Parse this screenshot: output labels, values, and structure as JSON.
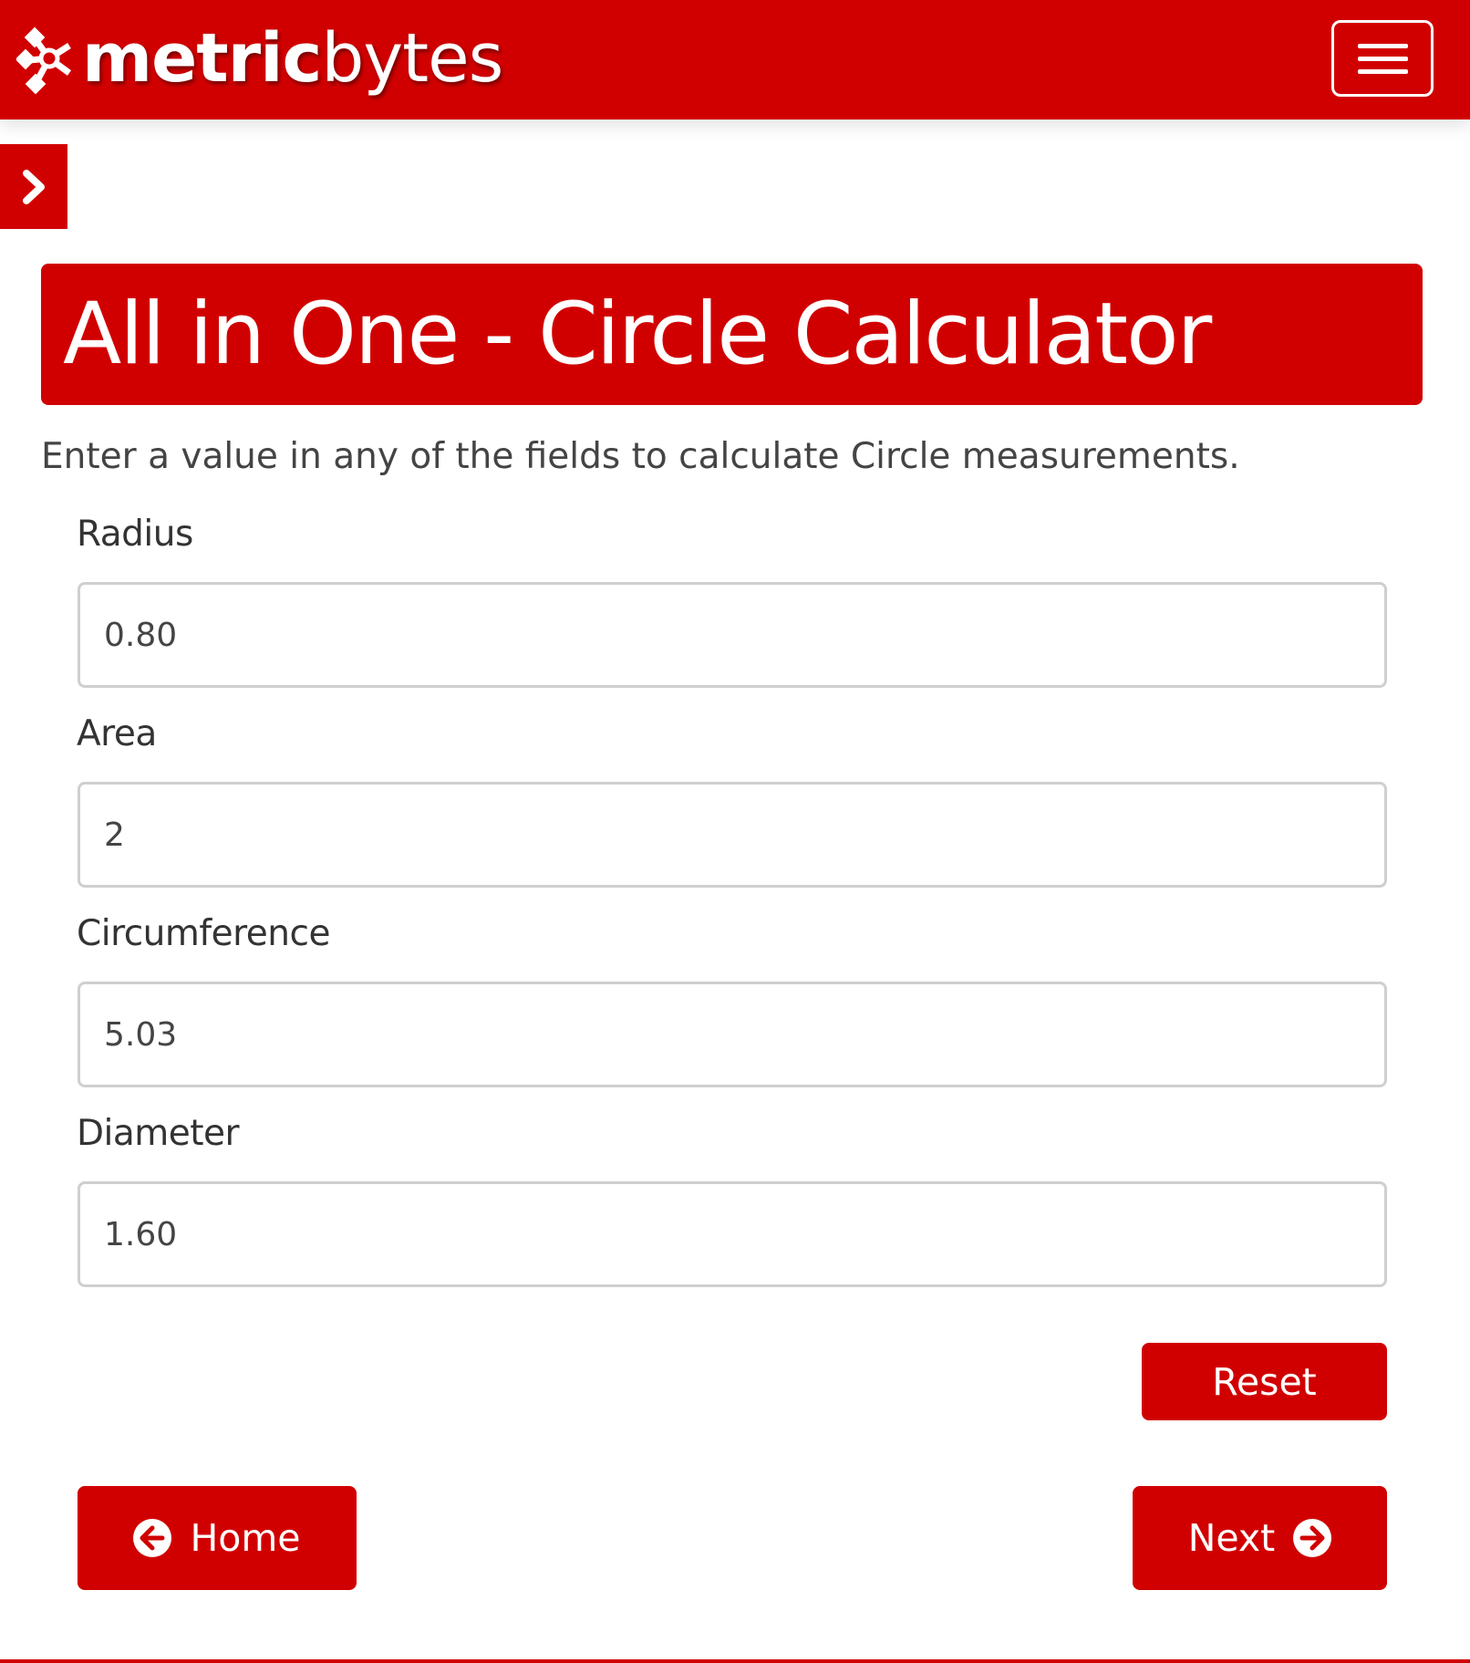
{
  "brand": {
    "name_bold": "metric",
    "name_light": "bytes",
    "logo_icon": "molecule-logo-icon"
  },
  "nav": {
    "menu_icon": "hamburger-menu-icon",
    "sidebar_toggle_icon": "chevron-right-icon"
  },
  "page": {
    "title": "All in One - Circle Calculator",
    "intro": "Enter a value in any of the fields to calculate Circle measurements."
  },
  "fields": {
    "radius": {
      "label": "Radius",
      "value": "0.80"
    },
    "area": {
      "label": "Area",
      "value": "2"
    },
    "circumference": {
      "label": "Circumference",
      "value": "5.03"
    },
    "diameter": {
      "label": "Diameter",
      "value": "1.60"
    }
  },
  "buttons": {
    "reset": "Reset",
    "home": "Home",
    "home_icon": "arrow-circle-left-icon",
    "next": "Next",
    "next_icon": "arrow-circle-right-icon"
  },
  "colors": {
    "brand_red": "#d10000",
    "input_border": "#cfcfcf",
    "text": "#333333"
  }
}
